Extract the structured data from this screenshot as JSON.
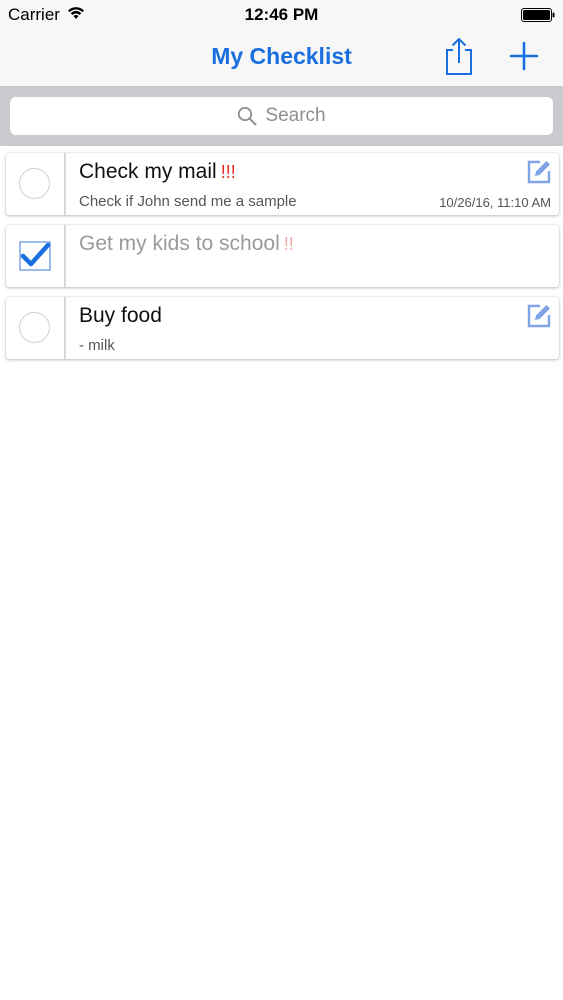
{
  "status_bar": {
    "carrier": "Carrier",
    "time": "12:46 PM",
    "wifi_icon": "wifi-icon",
    "battery_icon": "battery-icon"
  },
  "nav": {
    "title": "My Checklist",
    "share_icon": "share-icon",
    "add_icon": "plus-icon"
  },
  "search": {
    "placeholder": "Search",
    "icon": "search-icon"
  },
  "colors": {
    "accent": "#1a6fe0",
    "priority": "#e8281e",
    "search_bar_bg": "#c9c9ce",
    "edit_icon": "#7ea3e6"
  },
  "items": [
    {
      "title": "Check my mail",
      "priority": "!!!",
      "note": "Check if John send me a sample",
      "timestamp": "10/26/16, 11:10 AM",
      "checked": false
    },
    {
      "title": "Get my kids to school",
      "priority": "!!",
      "note": "",
      "timestamp": "",
      "checked": true
    },
    {
      "title": "Buy food",
      "priority": "",
      "note": "- milk",
      "timestamp": "",
      "checked": false
    }
  ]
}
